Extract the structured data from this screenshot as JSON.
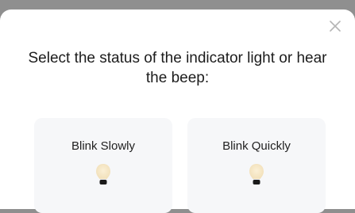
{
  "dialog": {
    "title": "Select the status of the indicator light or hear the beep:",
    "close_icon": "close-icon",
    "options": [
      {
        "label": "Blink Slowly",
        "icon": "light-bulb-icon"
      },
      {
        "label": "Blink Quickly",
        "icon": "light-bulb-icon"
      }
    ]
  },
  "colors": {
    "sheet_background": "#ffffff",
    "backdrop": "#8f8f8f",
    "card_background": "#f6f7f9",
    "bulb_glow": "#f7e7c4",
    "bulb_base": "#1a1a1a"
  }
}
